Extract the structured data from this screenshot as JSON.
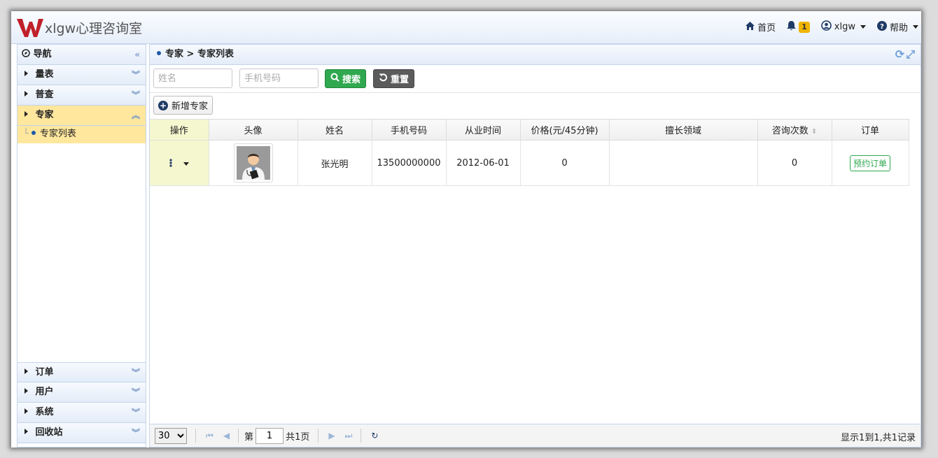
{
  "app": {
    "title": "xlgw心理咨询室"
  },
  "topnav": {
    "home": "首页",
    "notifications": "1",
    "user": "xlgw",
    "help": "帮助"
  },
  "sidebar": {
    "header": "导航",
    "items": [
      {
        "label": "量表"
      },
      {
        "label": "普查"
      },
      {
        "label": "专家"
      },
      {
        "label": "订单"
      },
      {
        "label": "用户"
      },
      {
        "label": "系统"
      },
      {
        "label": "回收站"
      }
    ],
    "subitem": "专家列表"
  },
  "main": {
    "breadcrumb": "专家 > 专家列表",
    "search": {
      "name_placeholder": "姓名",
      "phone_placeholder": "手机号码",
      "search_label": "搜索",
      "reset_label": "重置"
    },
    "add_label": "新增专家",
    "columns": [
      "操作",
      "头像",
      "姓名",
      "手机号码",
      "从业时间",
      "价格(元/45分钟)",
      "擅长领域",
      "咨询次数",
      "订单"
    ],
    "rows": [
      {
        "name": "张光明",
        "phone": "13500000000",
        "since": "2012-06-01",
        "price": "0",
        "field": "",
        "count": "0",
        "order": "预约订单"
      }
    ],
    "pager": {
      "page_size": "30",
      "page_prefix": "第",
      "page": "1",
      "page_suffix": "共1页",
      "info": "显示1到1,共1记录"
    }
  },
  "colors": {
    "accent": "#2fa84f",
    "active": "#ffe79e",
    "brand": "#c0202a"
  }
}
